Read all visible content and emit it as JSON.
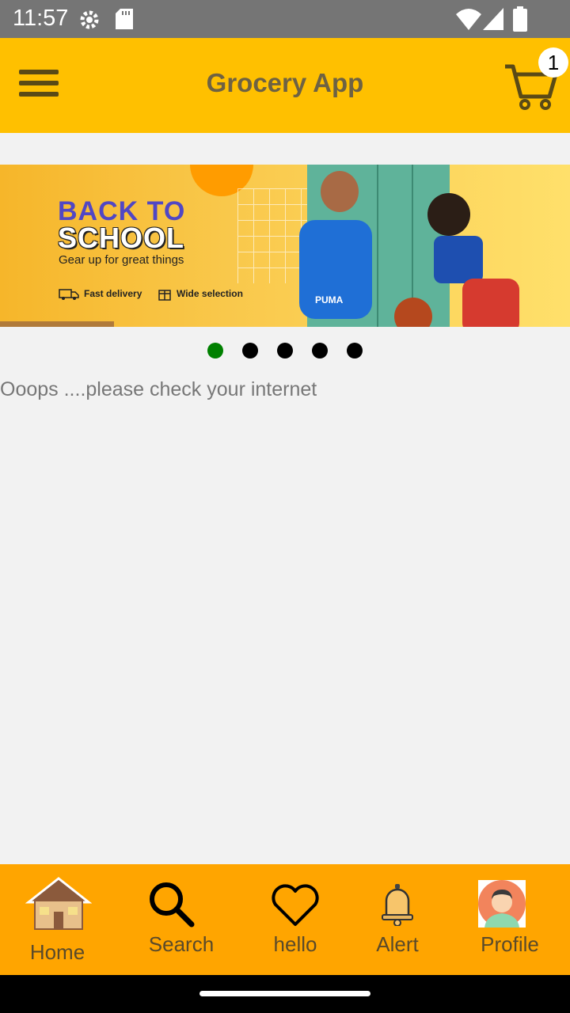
{
  "status_bar": {
    "time": "11:57",
    "icons": [
      "gear-icon",
      "sd-card-icon",
      "wifi-icon",
      "signal-icon",
      "battery-icon"
    ]
  },
  "app_bar": {
    "title": "Grocery App",
    "cart_count": "1",
    "background": "#ffc000"
  },
  "banner": {
    "title_line1": "BACK TO",
    "title_line2": "SCHOOL",
    "subtitle": "Gear up for great things",
    "feature1": "Fast delivery",
    "feature2": "Wide selection",
    "brand": "PUMA"
  },
  "carousel": {
    "active_index": 0,
    "total": 5
  },
  "error_message": "Ooops ....please check your internet",
  "bottom_nav": {
    "background": "#ffa500",
    "items": [
      {
        "label": "Home",
        "icon": "house-icon"
      },
      {
        "label": "Search",
        "icon": "search-icon"
      },
      {
        "label": "hello",
        "icon": "heart-icon"
      },
      {
        "label": "Alert",
        "icon": "bell-icon"
      },
      {
        "label": "Profile",
        "icon": "avatar-icon"
      }
    ]
  }
}
